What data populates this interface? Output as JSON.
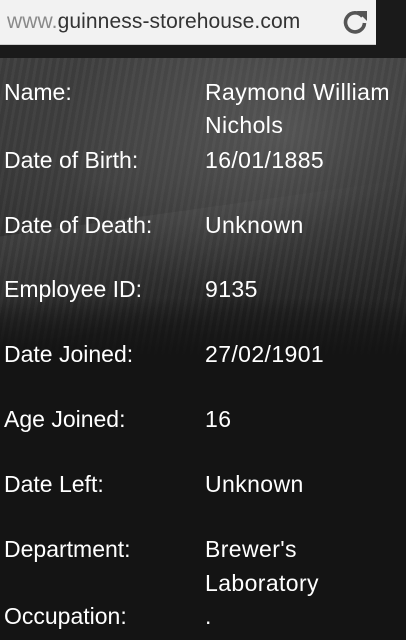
{
  "browser": {
    "url_prefix": "www.",
    "url_host": "guinness-storehouse.com"
  },
  "record": {
    "name_label": "Name:",
    "name_line1": "Raymond William",
    "name_line2": "Nichols",
    "dob_label": "Date of Birth:",
    "dob": "16/01/1885",
    "dod_label": "Date of Death:",
    "dod": "Unknown",
    "employee_id_label": "Employee ID:",
    "employee_id": "9135",
    "date_joined_label": "Date Joined:",
    "date_joined": "27/02/1901",
    "age_joined_label": "Age Joined:",
    "age_joined": "16",
    "date_left_label": "Date Left:",
    "date_left": "Unknown",
    "department_label": "Department:",
    "department_line1": "Brewer's",
    "department_line2": "Laboratory",
    "occupation_label": "Occupation:",
    "occupation": "."
  },
  "icons": {
    "reload": "reload-icon"
  },
  "colors": {
    "page_background": "#141414",
    "text": "#ffffff",
    "urlbar_background": "#f2f2f2",
    "reload_icon": "#555555"
  }
}
